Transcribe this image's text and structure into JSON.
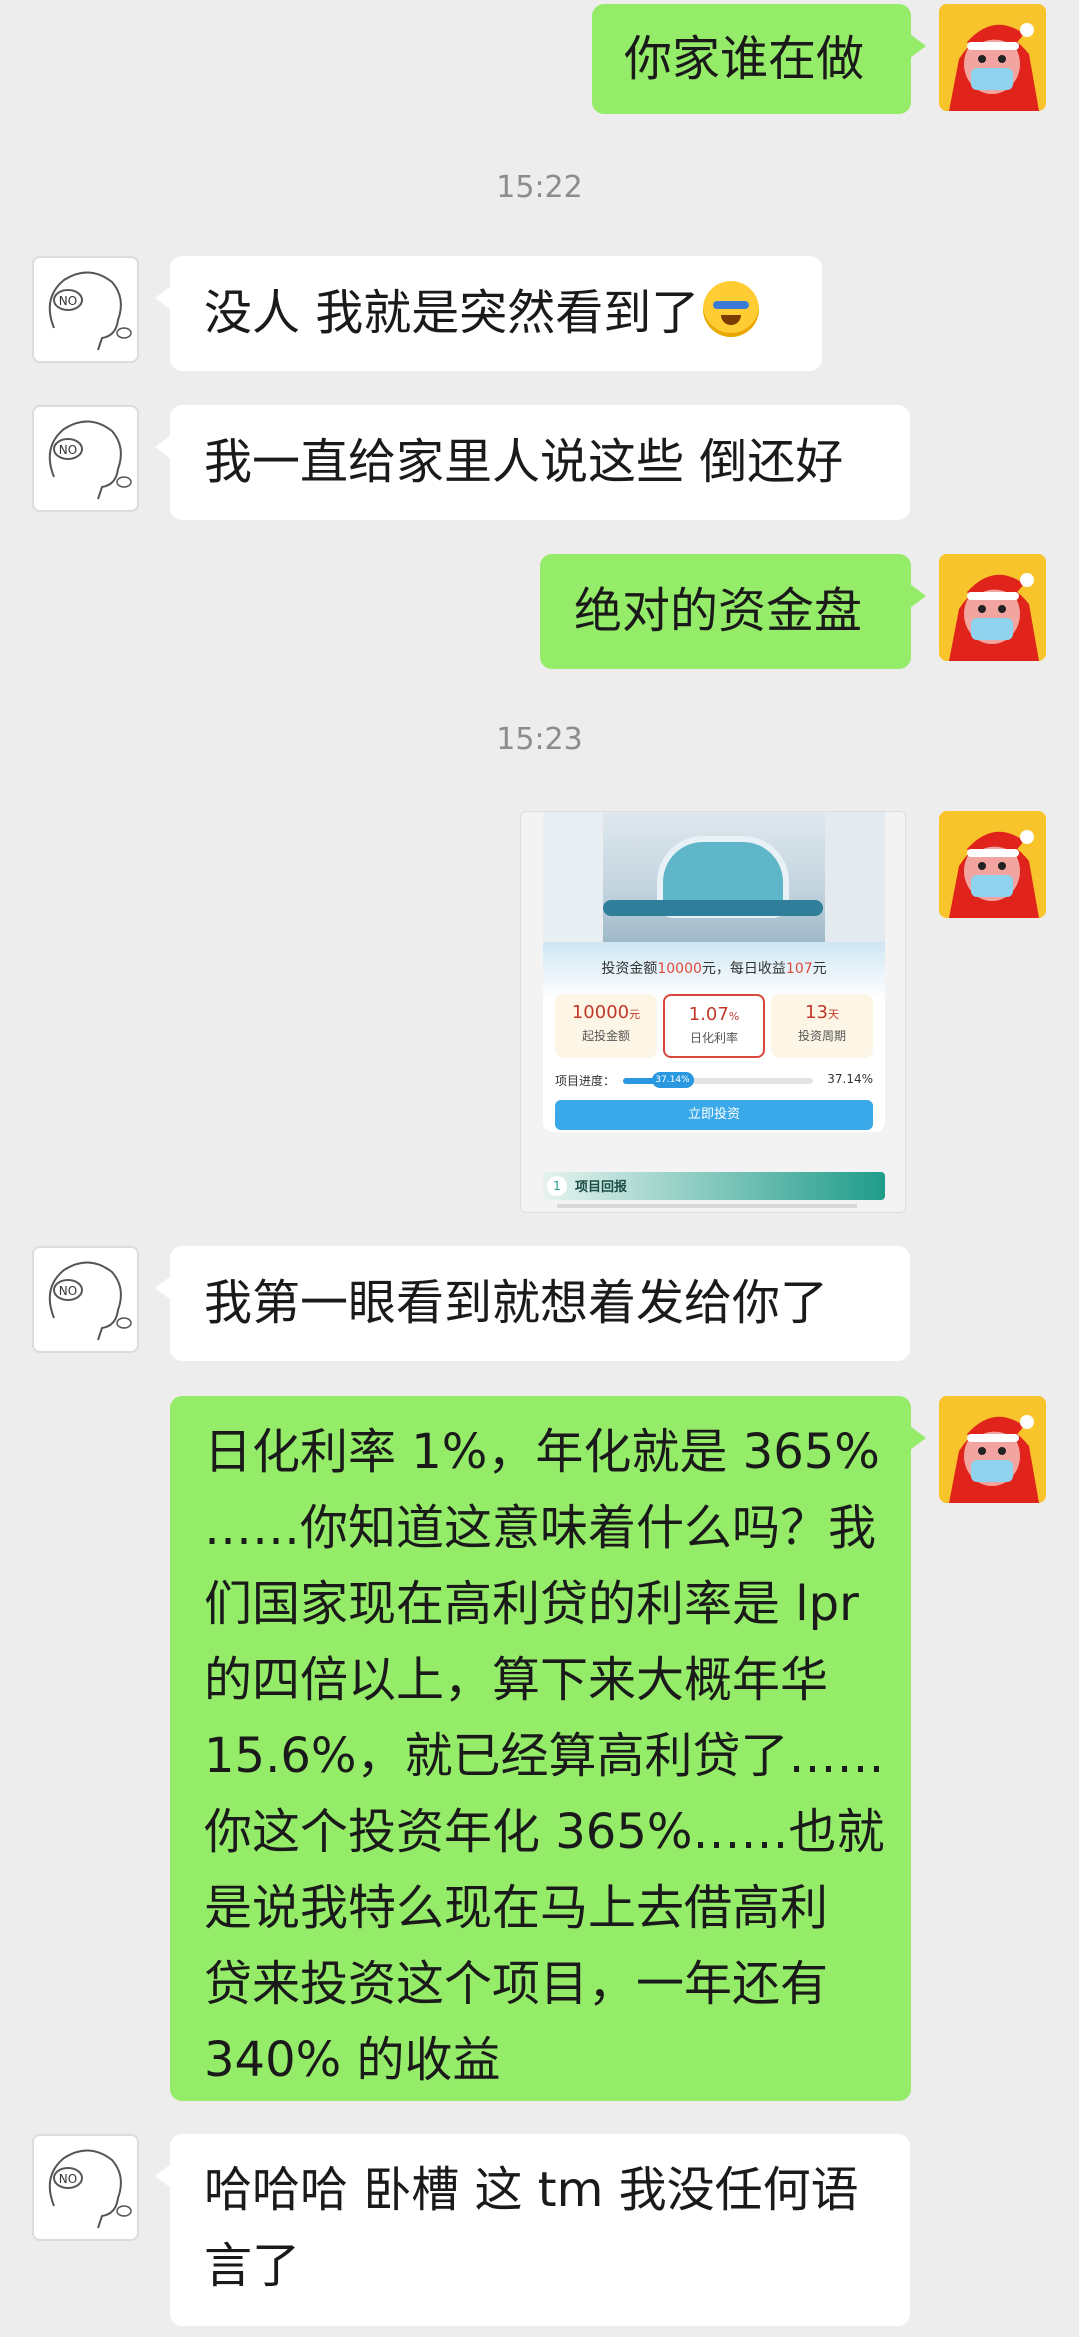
{
  "messages": {
    "m1": "你家谁在做",
    "t1": "15:22",
    "m2": "没人 我就是突然看到了",
    "m3": "我一直给家里人说这些 倒还好",
    "m4": "绝对的资金盘",
    "t2": "15:23",
    "m6": "我第一眼看到就想着发给你了",
    "m7": [
      "日化利率 1%，年化就是 365%",
      "……你知道这意味着什么吗？我",
      "们国家现在高利贷的利率是 lpr",
      "的四倍以上，算下来大概年华",
      "15.6%，就已经算高利贷了……",
      "你这个投资年化 365%……也就",
      "是说我特么现在马上去借高利",
      "贷来投资这个项目，一年还有",
      "340% 的收益"
    ],
    "m8": [
      "哈哈哈 卧槽 这 tm 我没任何语",
      "言了"
    ]
  },
  "avatars": {
    "other_label": "NO",
    "other_sub": "No",
    "self_icon": "santa-kid-mask-avatar"
  },
  "emoji": {
    "m2": "face-palm-emoji"
  },
  "card": {
    "head_prefix": "投资金额",
    "head_amount": "10000",
    "head_mid": "元，每日收益",
    "head_profit": "107",
    "head_suffix": "元",
    "stat1_value": "10000",
    "stat1_unit": "元",
    "stat1_label": "起投金额",
    "stat2_value": "1.07",
    "stat2_unit": "%",
    "stat2_label": "日化利率",
    "stat3_value": "13",
    "stat3_unit": "天",
    "stat3_label": "投资周期",
    "progress_label": "项目进度：",
    "progress_pct": "37.14%",
    "progress_value": 0.3714,
    "button": "立即投资",
    "section_num": "1",
    "section_title": "项目回报"
  },
  "colors": {
    "self_bubble": "#95ec69",
    "other_bubble": "#ffffff",
    "bg": "#ededed"
  }
}
